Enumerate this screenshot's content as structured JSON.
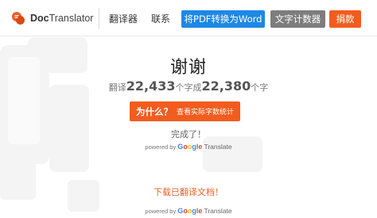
{
  "header": {
    "logo_text_bold": "Doc",
    "logo_text_rest": "Translator",
    "nav": [
      "翻译器",
      "联系"
    ],
    "buttons": {
      "pdf_to_word": "将PDF转换为Word",
      "word_counter": "文字计数器",
      "donate": "捐款"
    }
  },
  "colors": {
    "accent_blue": "#1e88e5",
    "accent_orange": "#f25c1f",
    "button_gray": "#7d7d7d"
  },
  "main": {
    "thanks": "谢谢",
    "stats": {
      "prefix": "翻译",
      "chars_in": "22,433",
      "middle": "个字成",
      "chars_out": "22,380",
      "suffix": "个字"
    },
    "why_button": {
      "label": "为什么？",
      "sub": "查看实际字数统计"
    },
    "done": "完成了！",
    "powered_by": "powered by",
    "google_letters": [
      "G",
      "o",
      "o",
      "g",
      "l",
      "e"
    ],
    "translate_word": "Translate",
    "download": "下载已翻译文档！"
  }
}
